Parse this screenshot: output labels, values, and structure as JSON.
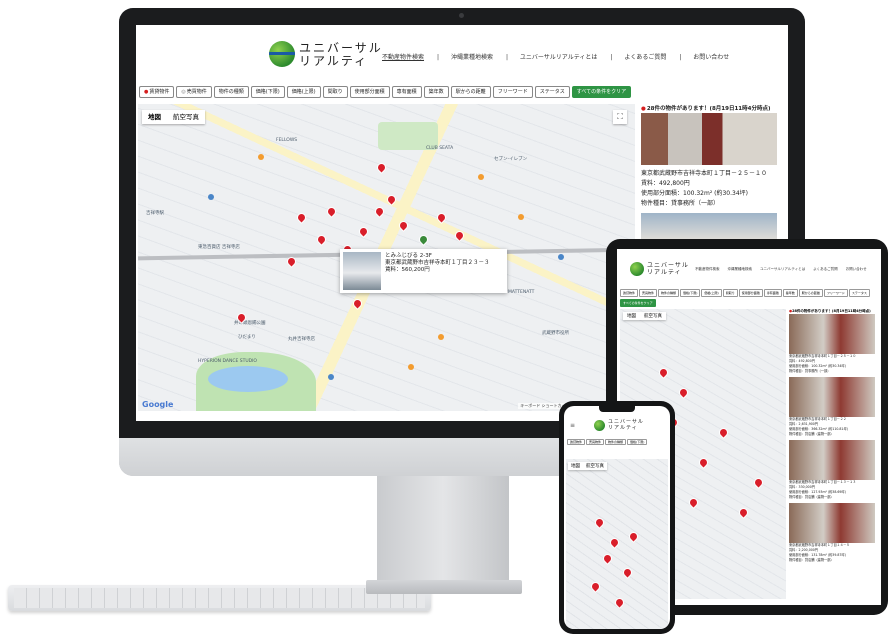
{
  "site": {
    "logo_line1": "ユニバーサル",
    "logo_line2": "リアルティ"
  },
  "nav": {
    "items": [
      "不動産物件検索",
      "沖縄業種地検索",
      "ユニバーサルリアルティとは",
      "よくあるご質問",
      "お問い合わせ"
    ]
  },
  "filters": {
    "items": [
      "賃貸物件",
      "売買物件",
      "物件の種類",
      "価格(下限)",
      "価格(上限)",
      "間取り",
      "使用部分面積",
      "専有面積",
      "築年数",
      "駅からの距離",
      "フリーワード",
      "ステータス"
    ],
    "clear_label": "すべての条件をクリア"
  },
  "map": {
    "tab_map": "地図",
    "tab_satellite": "航空写真",
    "fullscreen_icon": "fullscreen-icon",
    "google_label": "Google",
    "footer_text": "キーボード ショートカット　地図データ ©2023　利用規約",
    "labels": [
      "FELLOWS",
      "CLUB SEATA",
      "吉祥寺駅",
      "井の頭恩賜公園",
      "HYPERION DANCE STUDIO",
      "丸井吉祥寺店",
      "東急百貨店 吉祥寺店",
      "MATTENATT",
      "武蔵野市役所",
      "セブン-イレブン",
      "ひだまり"
    ],
    "popup": {
      "title": "とみふじびる 2-3F",
      "address": "東京都武蔵野市吉祥寺本町１丁目２３－３",
      "rent": "賃料：560,200円"
    }
  },
  "sidebar": {
    "count_text": "28件の物件があります！(8月19日11時4分時点)",
    "listing": {
      "address": "東京都武蔵野市吉祥寺本町１丁目－２５－１０",
      "rent": "賃料：492,800円",
      "area": "使用部分面積：100.32m² (約30.34坪)",
      "type": "物件種目：貸事務所（一部）"
    }
  },
  "tablet": {
    "logo_line1": "ユニバーサル",
    "logo_line2": "リアルティ",
    "nav_items": [
      "不動産物件検索",
      "沖縄業種地検索",
      "ユニバーサルリアルティとは",
      "よくあるご質問",
      "お問い合わせ"
    ],
    "filters": [
      "賃貸物件",
      "売買物件",
      "物件の種類",
      "価格(下限)",
      "価格(上限)",
      "間取り",
      "使用部分面積",
      "専有面積",
      "築年数",
      "駅からの距離",
      "フリーワード",
      "ステータス"
    ],
    "clear_label": "すべての条件をクリア",
    "tab_map": "地図",
    "tab_satellite": "航空写真",
    "count_text": "28件の物件があります！(8月19日11時4分時点)",
    "cards": [
      {
        "l1": "東京都武蔵野市吉祥寺本町１丁目－２５－１０",
        "l2": "賃料：492,800円",
        "l3": "使用部分面積：100.32m² (約30.34坪)",
        "l4": "物件種目：貸事務所（一部）"
      },
      {
        "l1": "東京都武蔵野市吉祥寺本町１丁目－２２",
        "l2": "賃料：2,631,900円",
        "l3": "使用部分面積：366.32m² (約110.81坪)",
        "l4": "物件種目：貸店舗（建物一部）"
      },
      {
        "l1": "東京都武蔵野市吉祥寺本町１丁目－１３－１３",
        "l2": "賃料：330,000円",
        "l3": "使用部分面積：127.93m² (約38.69坪)",
        "l4": "物件種目：貸店舗（建物一部）"
      },
      {
        "l1": "東京都武蔵野市吉祥寺本町１丁目１４－５",
        "l2": "賃料：2,200,000円",
        "l3": "使用部分面積：131.78m² (約39.87坪)",
        "l4": "物件種目：貸店舗（建物一部）"
      }
    ]
  },
  "phone": {
    "logo_line1": "ユニバーサル",
    "logo_line2": "リアルティ",
    "filters": [
      "賃貸物件",
      "売買物件",
      "物件の種類",
      "価格(下限)"
    ],
    "tab_map": "地図",
    "tab_satellite": "航空写真"
  },
  "colors": {
    "accent_green": "#2e9444",
    "pin_red": "#d91e2a",
    "logo_green": "#2e8b2e"
  }
}
